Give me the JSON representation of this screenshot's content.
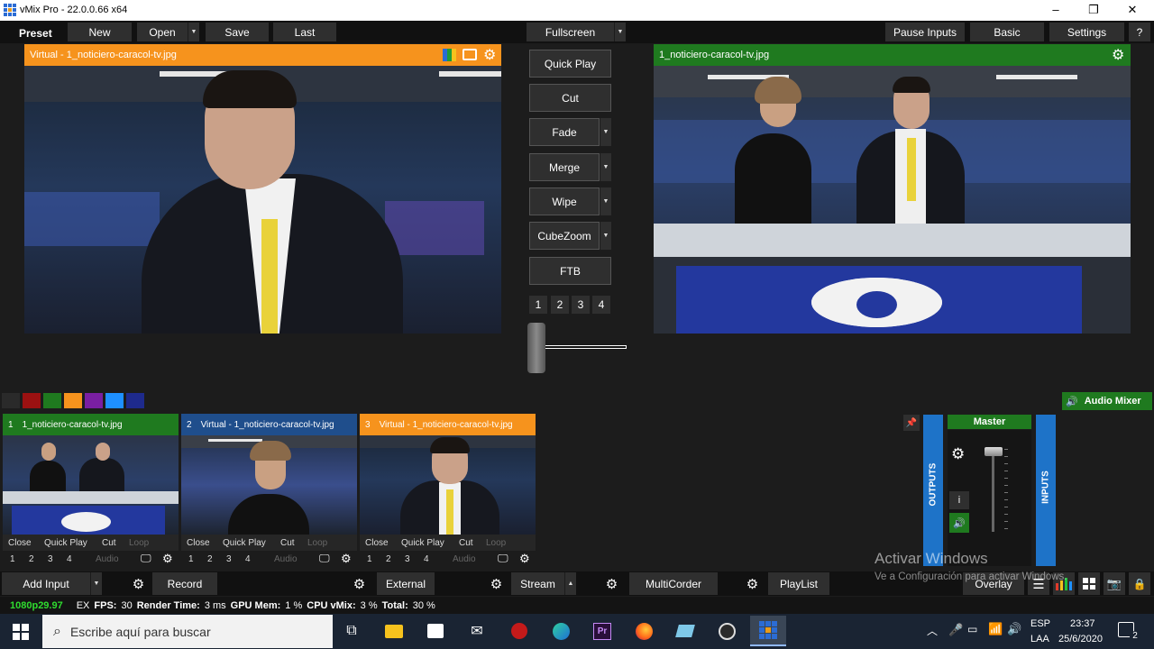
{
  "window": {
    "title": "vMix Pro - 22.0.0.66 x64",
    "controls": {
      "minimize": "–",
      "maximize": "❐",
      "close": "✕"
    }
  },
  "toolbar": {
    "preset": "Preset",
    "new": "New",
    "open": "Open",
    "save": "Save",
    "last": "Last",
    "fullscreen": "Fullscreen",
    "pause_inputs": "Pause Inputs",
    "basic": "Basic",
    "settings": "Settings",
    "help": "?"
  },
  "preview": {
    "title": "Virtual - 1_noticiero-caracol-tv.jpg"
  },
  "output": {
    "title": "1_noticiero-caracol-tv.jpg"
  },
  "transitions": {
    "quick_play": "Quick Play",
    "cut": "Cut",
    "fade": "Fade",
    "merge": "Merge",
    "wipe": "Wipe",
    "cubezoom": "CubeZoom",
    "ftb": "FTB",
    "numbers": [
      "1",
      "2",
      "3",
      "4"
    ],
    "tbar_position": 0
  },
  "colors": {
    "preview_orange": "#f6931d",
    "output_green": "#1f7a1f",
    "input_blue": "#1f4e8c",
    "mixer_blue": "#1e73c8",
    "swatches": [
      "#2a2a2a",
      "#9b1111",
      "#1f7a1f",
      "#f6931d",
      "#7a1fa2",
      "#1e90ff",
      "#1e2a8c"
    ]
  },
  "audio_mixer": {
    "label": "Audio Mixer",
    "master": "Master",
    "outputs": "OUTPUTS",
    "inputs": "INPUTS",
    "info": "i"
  },
  "inputs": [
    {
      "number": "1",
      "name": "1_noticiero-caracol-tv.jpg",
      "state": "output",
      "buttons": [
        "Close",
        "Quick Play",
        "Cut",
        "Loop"
      ],
      "audio": "Audio",
      "slots": [
        "1",
        "2",
        "3",
        "4"
      ]
    },
    {
      "number": "2",
      "name": "Virtual - 1_noticiero-caracol-tv.jpg",
      "state": "idle",
      "buttons": [
        "Close",
        "Quick Play",
        "Cut",
        "Loop"
      ],
      "audio": "Audio",
      "slots": [
        "1",
        "2",
        "3",
        "4"
      ]
    },
    {
      "number": "3",
      "name": "Virtual - 1_noticiero-caracol-tv.jpg",
      "state": "preview",
      "buttons": [
        "Close",
        "Quick Play",
        "Cut",
        "Loop"
      ],
      "audio": "Audio",
      "slots": [
        "1",
        "2",
        "3",
        "4"
      ]
    }
  ],
  "bottom_bar": {
    "add_input": "Add Input",
    "record": "Record",
    "external": "External",
    "stream": "Stream",
    "multicorder": "MultiCorder",
    "playlist": "PlayList",
    "overlay": "Overlay"
  },
  "status": {
    "format": "1080p29.97",
    "ex": "EX",
    "fps_label": "FPS:",
    "fps": "30",
    "render_label": "Render Time:",
    "render": "3 ms",
    "gpu_label": "GPU Mem:",
    "gpu": "1 %",
    "cpu_label": "CPU vMix:",
    "cpu": "3 %",
    "total_label": "Total:",
    "total": "30 %"
  },
  "watermark": {
    "title": "Activar Windows",
    "subtitle": "Ve a Configuración para activar Windows."
  },
  "taskbar": {
    "search_placeholder": "Escribe aquí para buscar",
    "language": "ESP",
    "layout": "LAA",
    "time": "23:37",
    "date": "25/6/2020",
    "notifications": "2",
    "premiere": "Pr"
  }
}
